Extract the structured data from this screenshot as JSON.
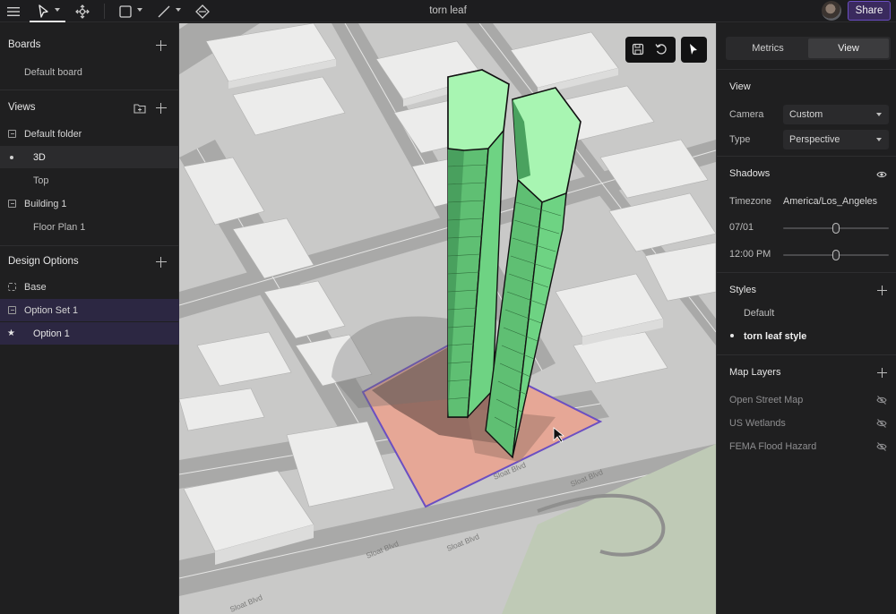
{
  "topbar": {
    "title": "torn leaf",
    "share_label": "Share",
    "icons": [
      "menu-icon",
      "select-arrow-icon",
      "orbit-icon",
      "rectangle-icon",
      "line-icon",
      "fill-icon"
    ]
  },
  "left_panel": {
    "boards": {
      "heading": "Boards",
      "items": [
        "Default board"
      ]
    },
    "views": {
      "heading": "Views",
      "items": [
        {
          "label": "Default folder",
          "kind": "folder"
        },
        {
          "label": "3D",
          "kind": "view",
          "selected": true
        },
        {
          "label": "Top",
          "kind": "view"
        },
        {
          "label": "Building 1",
          "kind": "folder"
        },
        {
          "label": "Floor Plan 1",
          "kind": "view"
        }
      ]
    },
    "design_options": {
      "heading": "Design Options",
      "items": [
        {
          "label": "Base"
        },
        {
          "label": "Option Set 1"
        },
        {
          "label": "Option 1"
        }
      ]
    }
  },
  "viewport": {
    "street_labels": [
      "Sloat Blvd",
      "Sloat Blvd",
      "Sloat Blvd",
      "Sloat Blvd",
      "Sloat Blvd"
    ],
    "toolbar_icons": [
      "save-icon",
      "undo-icon",
      "pointer-icon"
    ]
  },
  "right_panel": {
    "tabs": [
      "Metrics",
      "View"
    ],
    "active_tab": "View",
    "view": {
      "heading": "View",
      "camera_label": "Camera",
      "camera_value": "Custom",
      "type_label": "Type",
      "type_value": "Perspective"
    },
    "shadows": {
      "heading": "Shadows",
      "timezone_label": "Timezone",
      "timezone_value": "America/Los_Angeles",
      "date_label": "07/01",
      "date_fraction": 0.5,
      "time_label": "12:00 PM",
      "time_fraction": 0.5
    },
    "styles": {
      "heading": "Styles",
      "items": [
        {
          "label": "Default",
          "active": false
        },
        {
          "label": "torn leaf style",
          "active": true
        }
      ]
    },
    "map_layers": {
      "heading": "Map Layers",
      "items": [
        "Open Street Map",
        "US Wetlands",
        "FEMA Flood Hazard"
      ]
    }
  },
  "colors": {
    "accent_purple": "#6b4fc2",
    "building_green": "#7fdc8f",
    "building_top": "#a8f5b2",
    "site_pink": "#e6a796"
  }
}
